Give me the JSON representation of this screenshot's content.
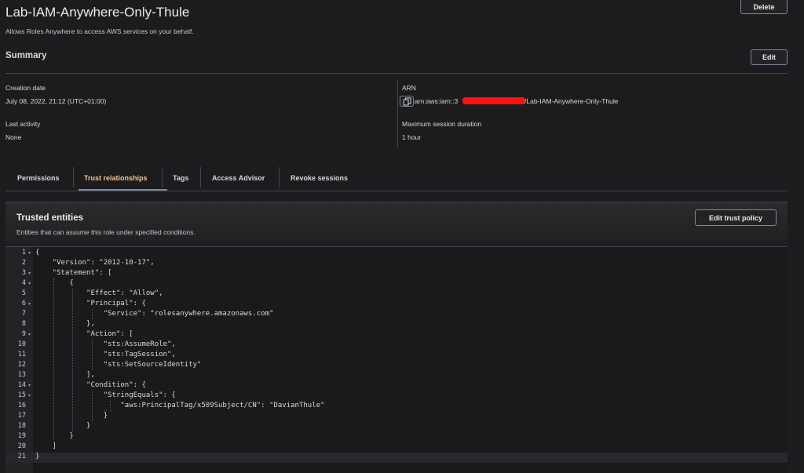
{
  "header": {
    "title": "Lab-IAM-Anywhere-Only-Thule",
    "subtitle": "Allows Roles Anywhere to access AWS services on your behalf.",
    "delete_label": "Delete"
  },
  "summary": {
    "title": "Summary",
    "edit_label": "Edit",
    "creation_date_label": "Creation date",
    "creation_date_value": "July 08, 2022, 21:12 (UTC+01:00)",
    "last_activity_label": "Last activity",
    "last_activity_value": "None",
    "arn_label": "ARN",
    "arn_prefix": "arn:aws:iam::3",
    "arn_suffix": "/Lab-IAM-Anywhere-Only-Thule",
    "max_session_label": "Maximum session duration",
    "max_session_value": "1 hour"
  },
  "tabs": [
    {
      "label": "Permissions"
    },
    {
      "label": "Trust relationships",
      "active": true
    },
    {
      "label": "Tags"
    },
    {
      "label": "Access Advisor"
    },
    {
      "label": "Revoke sessions"
    }
  ],
  "trusted": {
    "title": "Trusted entities",
    "description": "Entities that can assume this role under specified conditions.",
    "edit_label": "Edit trust policy"
  },
  "policy_lines": [
    "{",
    "    \"Version\": \"2012-10-17\",",
    "    \"Statement\": [",
    "        {",
    "            \"Effect\": \"Allow\",",
    "            \"Principal\": {",
    "                \"Service\": \"rolesanywhere.amazonaws.com\"",
    "            },",
    "            \"Action\": [",
    "                \"sts:AssumeRole\",",
    "                \"sts:TagSession\",",
    "                \"sts:SetSourceIdentity\"",
    "            ],",
    "            \"Condition\": {",
    "                \"StringEquals\": {",
    "                    \"aws:PrincipalTag/x509Subject/CN\": \"DavianThule\"",
    "                }",
    "            }",
    "        }",
    "    ]",
    "}"
  ],
  "line_numbers": [
    "1",
    "2",
    "3",
    "4",
    "5",
    "6",
    "7",
    "8",
    "9",
    "10",
    "11",
    "12",
    "13",
    "14",
    "15",
    "16",
    "17",
    "18",
    "19",
    "20",
    "21"
  ],
  "fold_lines": [
    1,
    3,
    4,
    6,
    9,
    14,
    15
  ],
  "colors": {
    "accent_tab": "#f2c48e",
    "redaction": "#ff1212"
  },
  "icons": {
    "copy": "copy-icon",
    "fold": "fold-caret-icon"
  }
}
